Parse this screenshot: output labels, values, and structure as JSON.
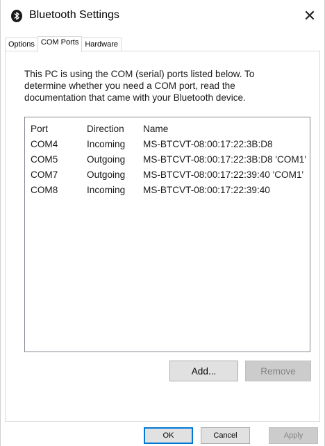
{
  "window": {
    "title": "Bluetooth Settings",
    "close_glyph": "✕",
    "icon": "bluetooth-icon"
  },
  "tabs": [
    {
      "label": "Options",
      "active": false
    },
    {
      "label": "COM Ports",
      "active": true
    },
    {
      "label": "Hardware",
      "active": false
    }
  ],
  "panel": {
    "description_lines": [
      "This PC is using the COM (serial) ports listed below. To",
      "determine whether you need a COM port, read the",
      "documentation that came with your Bluetooth device."
    ],
    "columns": [
      "Port",
      "Direction",
      "Name"
    ],
    "rows": [
      {
        "port": "COM4",
        "direction": "Incoming",
        "name": "MS-BTCVT-08:00:17:22:3B:D8"
      },
      {
        "port": "COM5",
        "direction": "Outgoing",
        "name": "MS-BTCVT-08:00:17:22:3B:D8 'COM1'"
      },
      {
        "port": "COM7",
        "direction": "Outgoing",
        "name": "MS-BTCVT-08:00:17:22:39:40 'COM1'"
      },
      {
        "port": "COM8",
        "direction": "Incoming",
        "name": "MS-BTCVT-08:00:17:22:39:40"
      }
    ],
    "add_label": "Add...",
    "remove_label": "Remove"
  },
  "footer": {
    "ok_label": "OK",
    "cancel_label": "Cancel",
    "apply_label": "Apply"
  },
  "colors": {
    "accent": "#0078d7",
    "bluetooth_icon_bg": "#1a1a1a",
    "disabled_text": "#838383"
  }
}
